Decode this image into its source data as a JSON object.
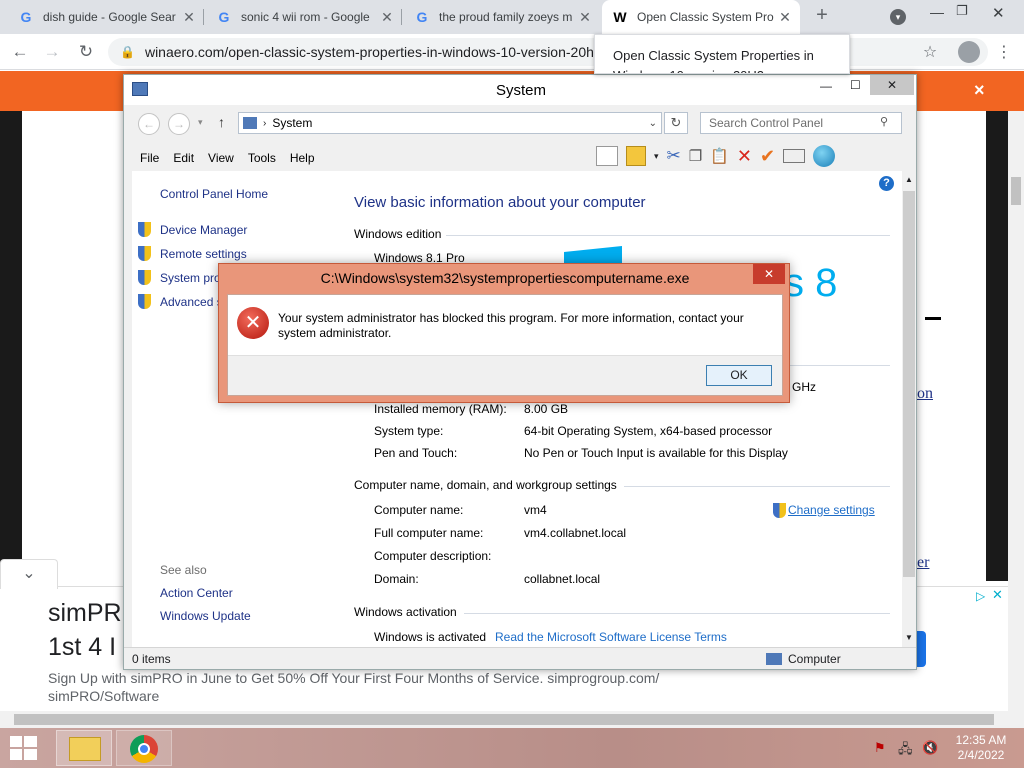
{
  "browser": {
    "tabs": [
      {
        "favicon": "G",
        "title": "dish guide - Google Sear"
      },
      {
        "favicon": "G",
        "title": "sonic 4 wii rom - Google"
      },
      {
        "favicon": "G",
        "title": "the proud family zoeys m"
      },
      {
        "favicon": "W",
        "title": "Open Classic System Pro"
      }
    ],
    "new_tab": "+",
    "url": "winaero.com/open-classic-system-properties-in-windows-10-version-20h",
    "tooltip": "Open Classic System Properties in Windows 10 version 20H2",
    "banner_close": "×"
  },
  "window": {
    "title": "System",
    "address_crumb": "System",
    "search_placeholder": "Search Control Panel",
    "menu": [
      "File",
      "Edit",
      "View",
      "Tools",
      "Help"
    ],
    "sidebar": {
      "home": "Control Panel Home",
      "links": [
        "Device Manager",
        "Remote settings",
        "System pro",
        "Advanced s"
      ],
      "see_also": "See also",
      "see_also_links": [
        "Action Center",
        "Windows Update"
      ]
    },
    "heading": "View basic information about your computer",
    "edition_section": "Windows edition",
    "edition": "Windows 8.1 Pro",
    "logo_text": "vs 8",
    "processor_partial": "GHz",
    "rows": [
      {
        "label": "Installed memory (RAM):",
        "value": "8.00 GB"
      },
      {
        "label": "System type:",
        "value": "64-bit Operating System, x64-based processor"
      },
      {
        "label": "Pen and Touch:",
        "value": "No Pen or Touch Input is available for this Display"
      }
    ],
    "name_section": "Computer name, domain, and workgroup settings",
    "name_rows": [
      {
        "label": "Computer name:",
        "value": "vm4"
      },
      {
        "label": "Full computer name:",
        "value": "vm4.collabnet.local"
      },
      {
        "label": "Computer description:",
        "value": ""
      },
      {
        "label": "Domain:",
        "value": "collabnet.local"
      }
    ],
    "change_settings": "Change settings",
    "activation_section": "Windows activation",
    "activation_status": "Windows is activated",
    "license_link": "Read the Microsoft Software License Terms",
    "status_items": "0 items",
    "status_computer": "Computer"
  },
  "dialog": {
    "title": "C:\\Windows\\system32\\systempropertiescomputername.exe",
    "message": "Your system administrator has blocked this program. For more information, contact your system administrator.",
    "ok": "OK"
  },
  "ad": {
    "headline1": "simPR",
    "headline2": "1st 4 I",
    "body": "Sign Up with simPRO in June to Get 50% Off Your First Four Months of Service. simprogroup.com/ simPRO/Software"
  },
  "page_partial": {
    "link1": "on",
    "link2": "er"
  },
  "taskbar": {
    "time": "12:35 AM",
    "date": "2/4/2022"
  },
  "colors": {
    "accent_orange": "#f26522",
    "dialog_frame": "#e9967a",
    "link_blue": "#1e3287",
    "win_logo": "#00adef"
  }
}
